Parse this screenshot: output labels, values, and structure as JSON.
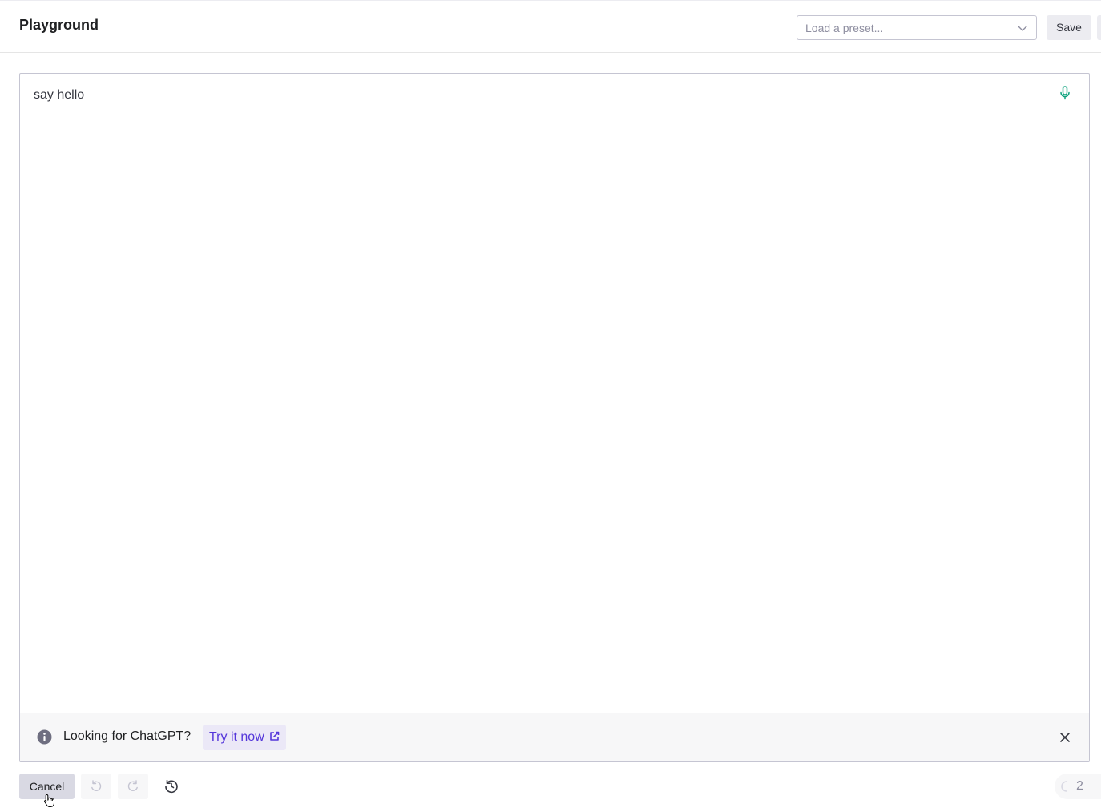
{
  "header": {
    "title": "Playground",
    "preset_placeholder": "Load a preset...",
    "save_label": "Save"
  },
  "editor": {
    "prompt_text": "say hello",
    "mic_icon": "microphone-icon"
  },
  "banner": {
    "text": "Looking for ChatGPT?",
    "link_label": "Try it now",
    "info_icon": "info-icon",
    "external_icon": "external-link-icon",
    "close_icon": "close-icon"
  },
  "footer": {
    "cancel_label": "Cancel",
    "undo_icon": "undo-icon",
    "redo_icon": "redo-icon",
    "history_icon": "history-icon",
    "token_count": "2"
  },
  "colors": {
    "accent_purple": "#5436da",
    "mic_green": "#10a37f",
    "text_dark": "#202123",
    "muted": "#8e8ea0"
  }
}
